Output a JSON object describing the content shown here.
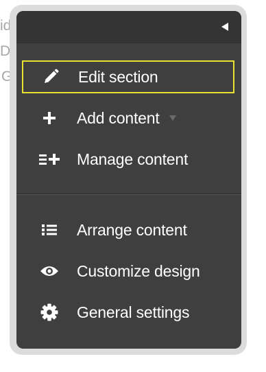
{
  "background": {
    "fragments": [
      "idc",
      "Det",
      "G"
    ]
  },
  "menu": {
    "collapse_icon": "triangle-left-icon",
    "items": [
      {
        "label": "Edit section",
        "icon": "pencil-icon",
        "selected": true
      },
      {
        "label": "Add content",
        "icon": "plus-icon",
        "has_dropdown": true
      },
      {
        "label": "Manage content",
        "icon": "list-plus-icon"
      },
      {
        "label": "Arrange content",
        "icon": "list-icon"
      },
      {
        "label": "Customize design",
        "icon": "eye-icon"
      },
      {
        "label": "General settings",
        "icon": "gear-icon"
      }
    ]
  },
  "colors": {
    "panel_bg": "#3f3f3f",
    "header_bg": "#343434",
    "highlight": "#e8e232",
    "frame": "#dcdcdc",
    "text": "#ffffff"
  }
}
